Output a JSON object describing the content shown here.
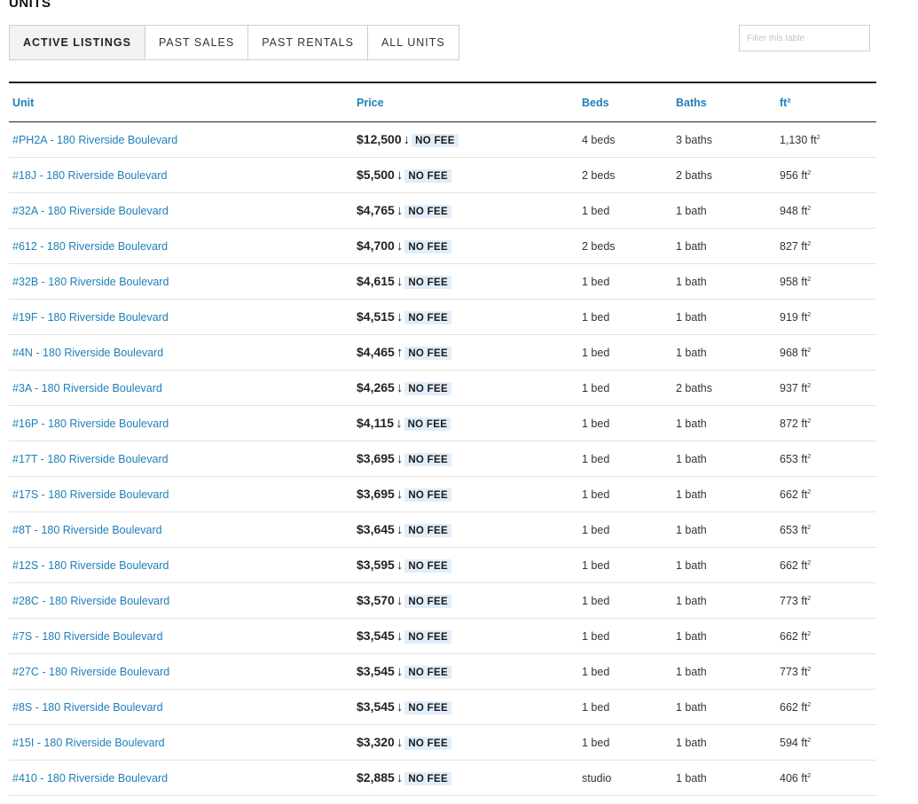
{
  "section_title": "UNITS",
  "tabs": [
    {
      "label": "ACTIVE LISTINGS",
      "active": true
    },
    {
      "label": "PAST SALES",
      "active": false
    },
    {
      "label": "PAST RENTALS",
      "active": false
    },
    {
      "label": "ALL UNITS",
      "active": false
    }
  ],
  "filter": {
    "placeholder": "Filter this table",
    "value": ""
  },
  "table": {
    "columns": [
      "Unit",
      "Price",
      "Beds",
      "Baths",
      "ft²"
    ],
    "sqft_unit": "ft",
    "sqft_sup": "2",
    "no_fee_label": "NO FEE",
    "rows": [
      {
        "unit": "#PH2A - 180 Riverside Boulevard",
        "price": "$12,500",
        "trend": "down",
        "beds": "4 beds",
        "baths": "3 baths",
        "sqft": "1,130"
      },
      {
        "unit": "#18J - 180 Riverside Boulevard",
        "price": "$5,500",
        "trend": "down",
        "beds": "2 beds",
        "baths": "2 baths",
        "sqft": "956"
      },
      {
        "unit": "#32A - 180 Riverside Boulevard",
        "price": "$4,765",
        "trend": "down",
        "beds": "1 bed",
        "baths": "1 bath",
        "sqft": "948"
      },
      {
        "unit": "#612 - 180 Riverside Boulevard",
        "price": "$4,700",
        "trend": "down",
        "beds": "2 beds",
        "baths": "1 bath",
        "sqft": "827"
      },
      {
        "unit": "#32B - 180 Riverside Boulevard",
        "price": "$4,615",
        "trend": "down",
        "beds": "1 bed",
        "baths": "1 bath",
        "sqft": "958"
      },
      {
        "unit": "#19F - 180 Riverside Boulevard",
        "price": "$4,515",
        "trend": "down",
        "beds": "1 bed",
        "baths": "1 bath",
        "sqft": "919"
      },
      {
        "unit": "#4N - 180 Riverside Boulevard",
        "price": "$4,465",
        "trend": "up",
        "beds": "1 bed",
        "baths": "1 bath",
        "sqft": "968"
      },
      {
        "unit": "#3A - 180 Riverside Boulevard",
        "price": "$4,265",
        "trend": "down",
        "beds": "1 bed",
        "baths": "2 baths",
        "sqft": "937"
      },
      {
        "unit": "#16P - 180 Riverside Boulevard",
        "price": "$4,115",
        "trend": "down",
        "beds": "1 bed",
        "baths": "1 bath",
        "sqft": "872"
      },
      {
        "unit": "#17T - 180 Riverside Boulevard",
        "price": "$3,695",
        "trend": "down",
        "beds": "1 bed",
        "baths": "1 bath",
        "sqft": "653"
      },
      {
        "unit": "#17S - 180 Riverside Boulevard",
        "price": "$3,695",
        "trend": "down",
        "beds": "1 bed",
        "baths": "1 bath",
        "sqft": "662"
      },
      {
        "unit": "#8T - 180 Riverside Boulevard",
        "price": "$3,645",
        "trend": "down",
        "beds": "1 bed",
        "baths": "1 bath",
        "sqft": "653"
      },
      {
        "unit": "#12S - 180 Riverside Boulevard",
        "price": "$3,595",
        "trend": "down",
        "beds": "1 bed",
        "baths": "1 bath",
        "sqft": "662"
      },
      {
        "unit": "#28C - 180 Riverside Boulevard",
        "price": "$3,570",
        "trend": "down",
        "beds": "1 bed",
        "baths": "1 bath",
        "sqft": "773"
      },
      {
        "unit": "#7S - 180 Riverside Boulevard",
        "price": "$3,545",
        "trend": "down",
        "beds": "1 bed",
        "baths": "1 bath",
        "sqft": "662"
      },
      {
        "unit": "#27C - 180 Riverside Boulevard",
        "price": "$3,545",
        "trend": "down",
        "beds": "1 bed",
        "baths": "1 bath",
        "sqft": "773"
      },
      {
        "unit": "#8S - 180 Riverside Boulevard",
        "price": "$3,545",
        "trend": "down",
        "beds": "1 bed",
        "baths": "1 bath",
        "sqft": "662"
      },
      {
        "unit": "#15I - 180 Riverside Boulevard",
        "price": "$3,320",
        "trend": "down",
        "beds": "1 bed",
        "baths": "1 bath",
        "sqft": "594"
      },
      {
        "unit": "#410 - 180 Riverside Boulevard",
        "price": "$2,885",
        "trend": "down",
        "beds": "studio",
        "baths": "1 bath",
        "sqft": "406"
      }
    ]
  },
  "icons": {
    "down": "arrow-down-icon",
    "up": "arrow-up-icon"
  },
  "colors": {
    "link": "#1d7fb8",
    "badge_bg": "#e1eef9",
    "active_tab_bg": "#f2f2f2"
  }
}
